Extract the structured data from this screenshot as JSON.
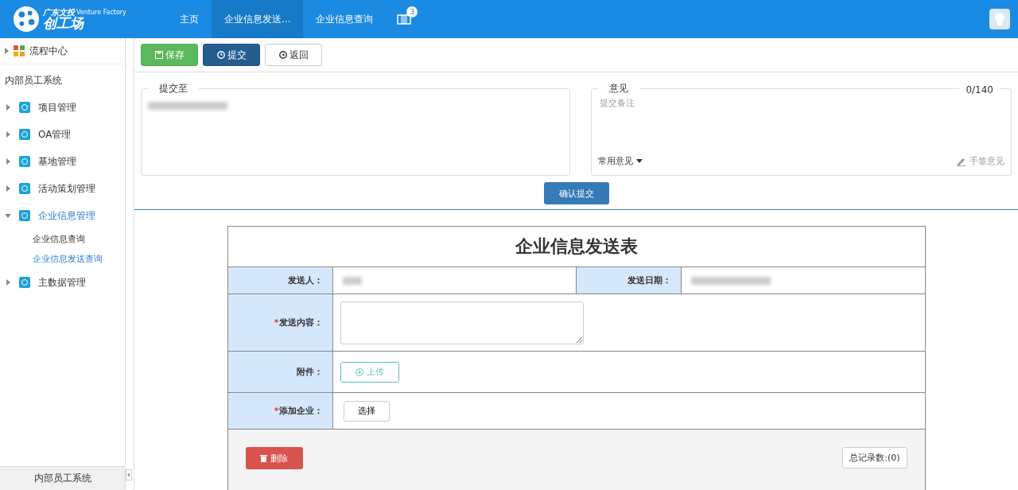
{
  "header": {
    "logo": {
      "line_1": "广东文投",
      "line_2": "Venture Factory",
      "line_3": "创工场"
    },
    "tabs": [
      {
        "label": "主页",
        "selected": false
      },
      {
        "label": "企业信息发送...",
        "selected": true
      },
      {
        "label": "企业信息查询",
        "selected": false
      }
    ],
    "notification_badge": "3"
  },
  "sidebar": {
    "top_item": "流程中心",
    "section_title": "内部员工系统",
    "items": [
      {
        "label": "项目管理",
        "expanded": false,
        "selected": false
      },
      {
        "label": "OA管理",
        "expanded": false,
        "selected": false
      },
      {
        "label": "基地管理",
        "expanded": false,
        "selected": false
      },
      {
        "label": "活动策划管理",
        "expanded": false,
        "selected": false
      },
      {
        "label": "企业信息管理",
        "expanded": true,
        "selected": true,
        "children": [
          {
            "label": "企业信息查询",
            "selected": false
          },
          {
            "label": "企业信息发送查询",
            "selected": true
          }
        ]
      },
      {
        "label": "主数据管理",
        "expanded": false,
        "selected": false
      }
    ],
    "footer": "内部员工系统"
  },
  "toolbar": [
    {
      "label": "保存",
      "kind": "save"
    },
    {
      "label": "提交",
      "kind": "submit"
    },
    {
      "label": "返回",
      "kind": "back"
    }
  ],
  "submit_panel": {
    "submit_to_label": "提交至",
    "opinion_label": "意见",
    "counter": "0/140",
    "opinion_placeholder": "提交备注",
    "common_opinions": "常用意见",
    "handwritten": "手签意见",
    "confirm_button": "确认提交"
  },
  "form": {
    "title": "企业信息发送表",
    "required_mark": "*",
    "sender_label": "发送人：",
    "date_label": "发送日期：",
    "rows": [
      {
        "label": "发送内容：",
        "required": true,
        "kind": "textarea"
      },
      {
        "label": "附件：",
        "required": false,
        "kind": "upload",
        "button": "上传"
      },
      {
        "label": "添加企业：",
        "required": true,
        "kind": "select",
        "button": "选择"
      }
    ],
    "delete_button": "删除",
    "total_records": "总记录数:(0)"
  }
}
